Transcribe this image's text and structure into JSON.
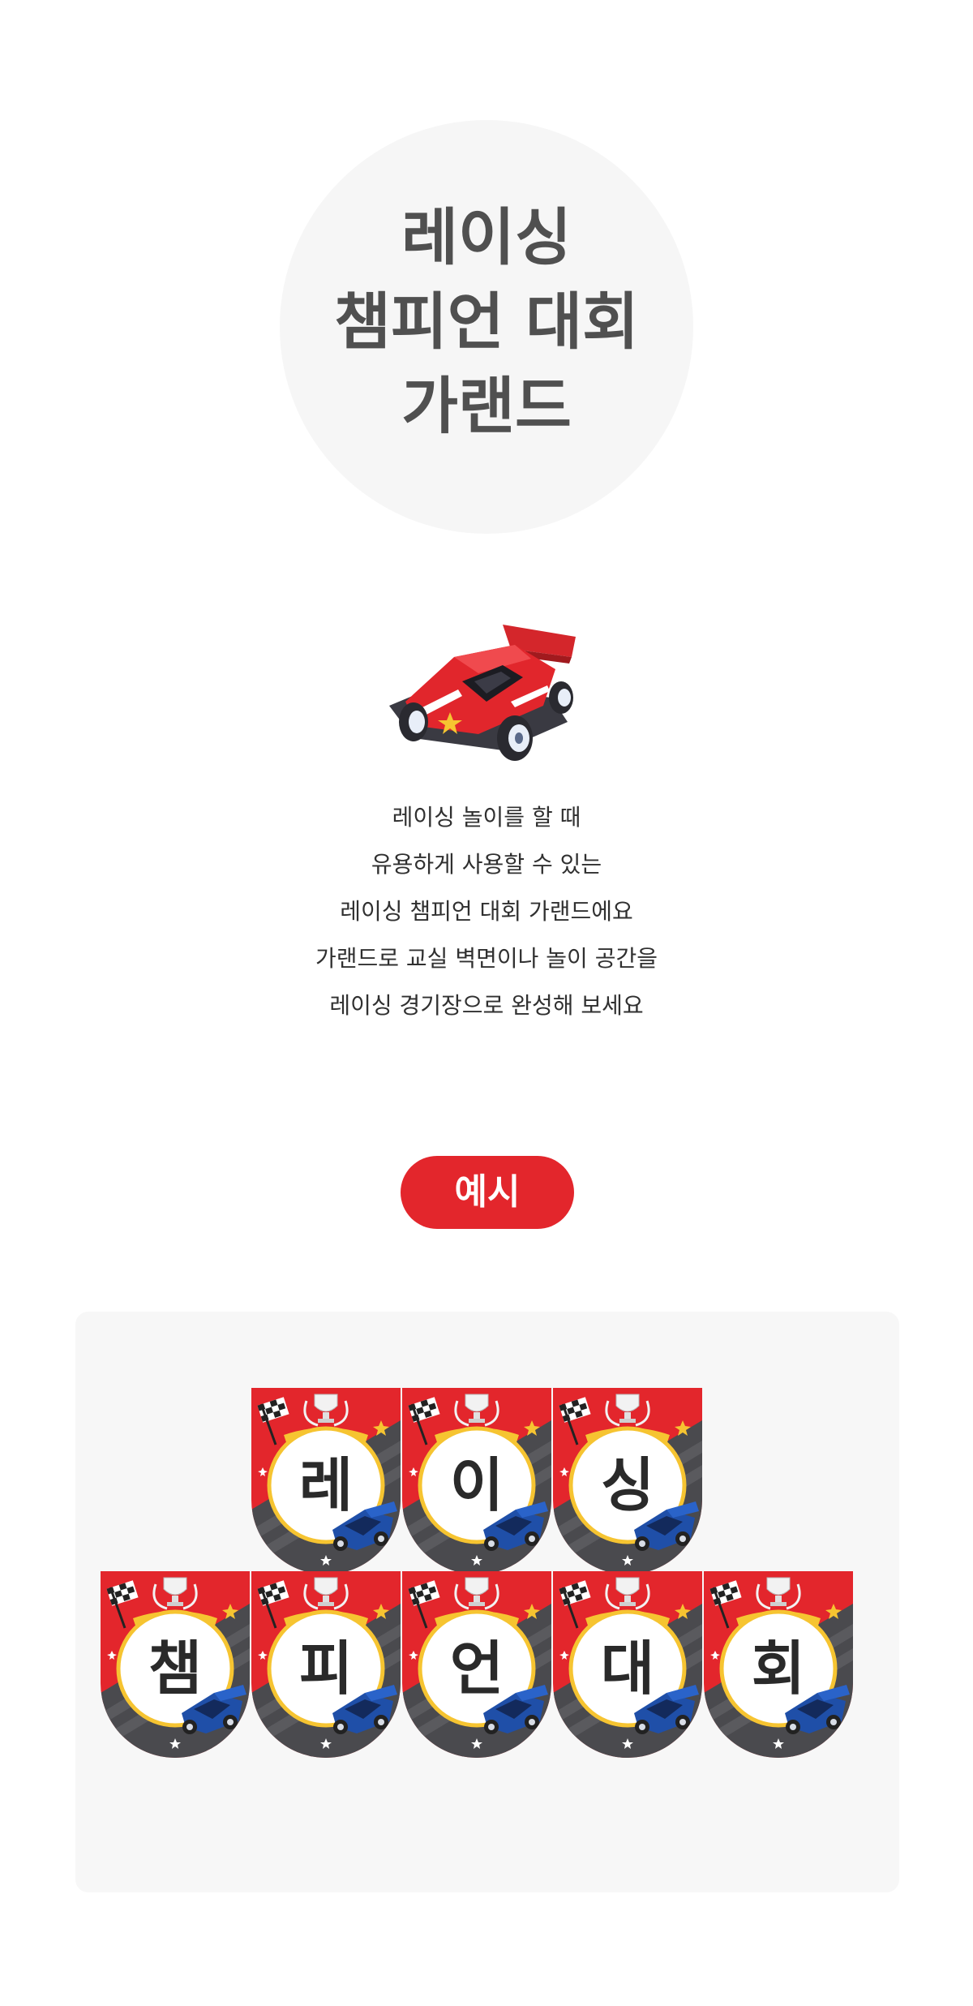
{
  "title": {
    "lines": [
      "레이싱",
      "챔피언 대회",
      "가랜드"
    ]
  },
  "hero_image": {
    "icon": "race-car-icon"
  },
  "description": {
    "lines": [
      "레이싱 놀이를 할 때",
      "유용하게 사용할 수 있는",
      "레이싱 챔피언 대회 가랜드에요",
      "가랜드로 교실 벽면이나 놀이 공간을",
      "레이싱 경기장으로 완성해 보세요"
    ]
  },
  "example_label": "예시",
  "garland": {
    "row1": [
      "레",
      "이",
      "싱"
    ],
    "row2": [
      "챔",
      "피",
      "언",
      "대",
      "회"
    ]
  },
  "colors": {
    "accent": "#e3262c",
    "title_text": "#505050",
    "panel_bg": "#f7f7f7",
    "circle_bg": "#f6f6f6"
  }
}
